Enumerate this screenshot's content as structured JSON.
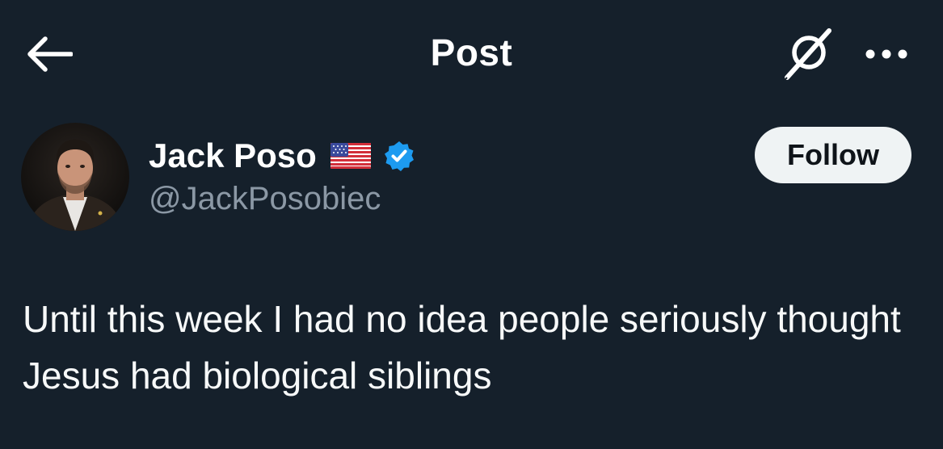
{
  "header": {
    "title": "Post",
    "back_icon": "arrow-left-icon",
    "grok_icon": "grok-icon",
    "more_icon": "more-horizontal-icon"
  },
  "author": {
    "display_name": "Jack Poso",
    "flag_emoji": "us-flag",
    "verified_icon": "verified-badge-icon",
    "verified_color": "#1d9bf0",
    "handle": "@JackPosobiec"
  },
  "actions": {
    "follow_label": "Follow"
  },
  "post": {
    "text": "Until this week I had no idea people seriously thought Jesus had biological siblings"
  },
  "colors": {
    "background": "#15202b",
    "text": "#f7f9f9",
    "secondary_text": "#8b98a5",
    "follow_bg": "#eff3f4"
  }
}
